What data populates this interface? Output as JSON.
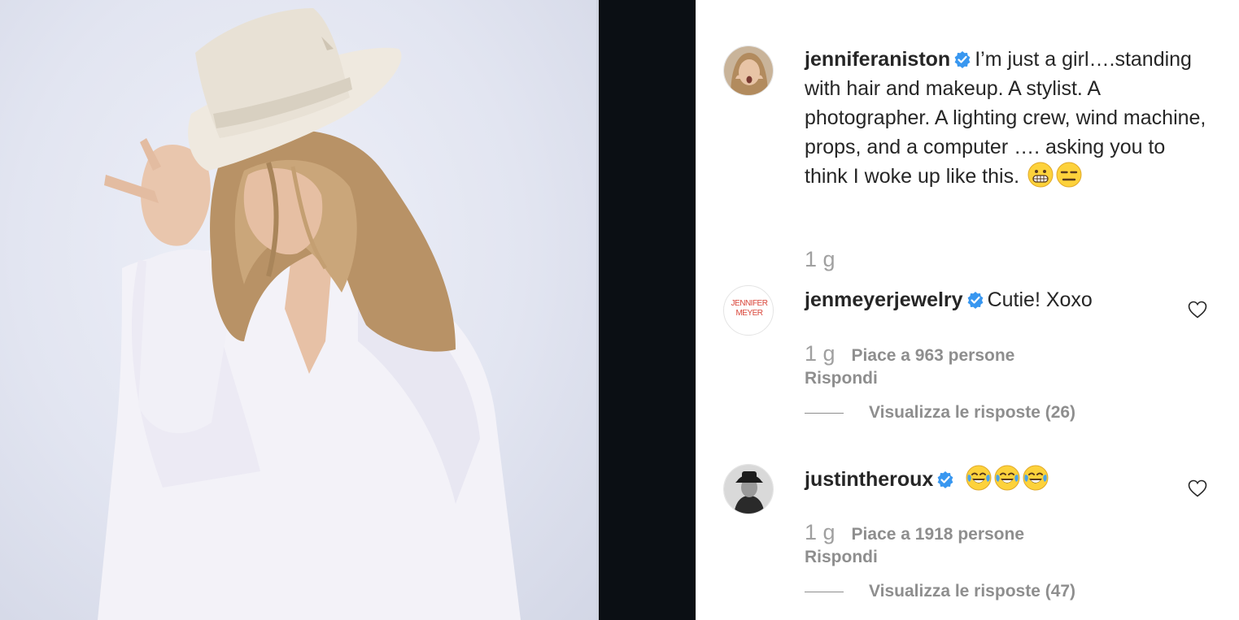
{
  "post": {
    "author": "jenniferaniston",
    "caption": "I’m just a girl….standing with hair and makeup. A stylist. A photographer. A lighting crew, wind machine, props, and a computer …. asking you to think I woke up like this.",
    "caption_emojis": [
      "grimacing-face",
      "expressionless-face"
    ],
    "age": "1 g"
  },
  "comments": [
    {
      "username": "jenmeyerjewelry",
      "text": "Cutie! Xoxo",
      "avatar_text": "JENNIFER MEYER",
      "age": "1 g",
      "likes": "Piace a 963 persone",
      "reply": "Rispondi",
      "view_replies": "Visualizza le risposte (26)"
    },
    {
      "username": "justintheroux",
      "text": "",
      "emojis": [
        "face-with-tears-of-joy",
        "face-with-tears-of-joy",
        "face-with-tears-of-joy"
      ],
      "age": "1 g",
      "likes": "Piace a 1918 persone",
      "reply": "Rispondi",
      "view_replies": "Visualizza le risposte (47)"
    }
  ],
  "colors": {
    "verified_blue": "#3897f0",
    "muted_text": "#8e8e8e",
    "text": "#262626"
  }
}
